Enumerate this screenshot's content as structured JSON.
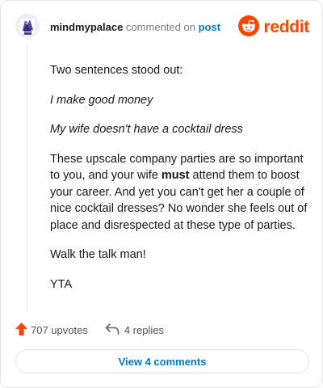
{
  "comment": {
    "author": "mindmypalace",
    "verb": "commented on",
    "post_link": "post",
    "brand": "reddit",
    "paragraphs": {
      "p1": "Two sentences stood out:",
      "p2": "I make good money",
      "p3": "My wife doesn't have a cocktail dress",
      "p4_part1": "These upscale company parties are so important to you, and your wife ",
      "p4_bold": "must",
      "p4_part2": " attend them to boost your career. And yet you can't get her a couple of nice cocktail dresses? No wonder she feels out of place and disrespected at these type of parties.",
      "p5": "Walk the talk man!",
      "p6": "YTA"
    }
  },
  "footer": {
    "upvotes": "707 upvotes",
    "replies": "4 replies",
    "view_comments": "View 4 comments"
  },
  "colors": {
    "brand": "#ff4500",
    "link": "#0079d3"
  },
  "icons": {
    "avatar": "avatar",
    "logo": "reddit-logo-icon",
    "upvote": "upvote-arrow-icon",
    "reply": "reply-icon"
  }
}
